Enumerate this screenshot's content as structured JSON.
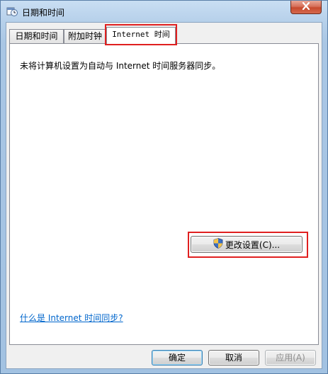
{
  "window": {
    "title": "日期和时间"
  },
  "tabs": [
    {
      "label": "日期和时间"
    },
    {
      "label": "附加时钟"
    },
    {
      "label": "Internet 时间"
    }
  ],
  "internet_time": {
    "status": "未将计算机设置为自动与 Internet 时间服务器同步。",
    "change_button_label": "更改设置(C)...",
    "help_link": "什么是 Internet 时间同步?"
  },
  "buttons": {
    "ok": "确定",
    "cancel": "取消",
    "apply": "应用(A)"
  },
  "colors": {
    "highlight_box": "#e02020",
    "link": "#0066cc"
  }
}
